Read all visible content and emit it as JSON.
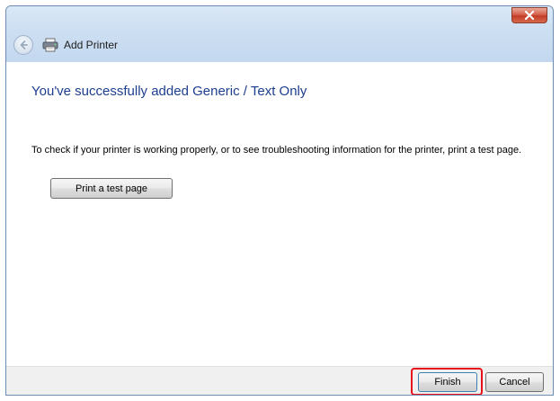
{
  "window": {
    "title": "Add Printer"
  },
  "page": {
    "heading": "You've successfully added Generic / Text Only",
    "description": "To check if your printer is working properly, or to see troubleshooting information for the printer, print a test page.",
    "test_page_button": "Print a test page"
  },
  "footer": {
    "finish_label": "Finish",
    "cancel_label": "Cancel"
  },
  "colors": {
    "heading": "#1d3e8f",
    "highlight": "#e8111b",
    "close_button": "#c23c26"
  },
  "icons": {
    "close": "close-x-icon",
    "back": "back-arrow-icon",
    "printer": "printer-icon"
  }
}
